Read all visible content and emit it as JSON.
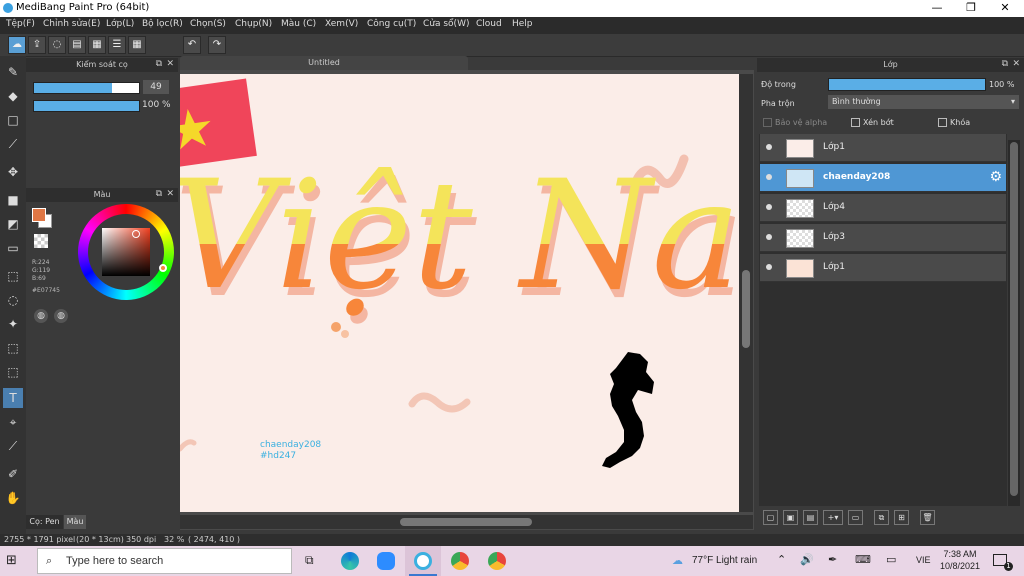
{
  "window": {
    "title": "MediBang Paint Pro (64bit)",
    "minimize": "—",
    "maximize": "❐",
    "close": "✕"
  },
  "menu": [
    "Tệp(F)",
    "Chỉnh sửa(E)",
    "Lớp(L)",
    "Bộ lọc(R)",
    "Chọn(S)",
    "Chụp(N)",
    "Màu (C)",
    "Xem(V)",
    "Công cụ(T)",
    "Cửa sổ(W)",
    "Cloud",
    "Help"
  ],
  "document": {
    "tab_title": "Untitled"
  },
  "brush_panel": {
    "title": "Kiểm soát cọ",
    "size_value": "49",
    "size_fraction": 0.74,
    "opacity_value": "100 %",
    "opacity_fraction": 1.0
  },
  "color_panel": {
    "title": "Màu",
    "r_label": "R:224",
    "g_label": "G:119",
    "b_label": "B:69",
    "hex_label": "#E07745",
    "primary_color": "#E07745",
    "secondary_color": "#ffffff"
  },
  "bottom_tabs": {
    "tab1": "Cọ: Pen",
    "tab2": "Màu"
  },
  "layer_panel": {
    "title": "Lớp",
    "opacity_label": "Độ trong",
    "opacity_value": "100 %",
    "opacity_fraction": 1.0,
    "blend_label": "Pha trộn",
    "blend_value": "Bình thường",
    "protect_alpha": "Bảo vệ alpha",
    "clipping": "Xén bớt",
    "lock": "Khóa",
    "layers": [
      {
        "name": "Lớp1",
        "selected": false
      },
      {
        "name": "chaenday208",
        "selected": true
      },
      {
        "name": "Lớp4",
        "selected": false
      },
      {
        "name": "Lớp3",
        "selected": false
      },
      {
        "name": "Lớp1",
        "selected": false
      }
    ]
  },
  "canvas": {
    "big_text": "Việt Nam",
    "watermark_line1": "chaenday208",
    "watermark_line2": "#hd247"
  },
  "status": {
    "size": "2755 * 1791 pixel",
    "cm": "(20 * 13cm)",
    "dpi": "350 dpi",
    "zoom": "32 %",
    "coords": "( 2474, 410 )"
  },
  "taskbar": {
    "search_placeholder": "Type here to search",
    "weather": "77°F  Light rain",
    "lang": "VIE",
    "time": "7:38 AM",
    "date": "10/8/2021",
    "notif_count": "1"
  },
  "colors": {
    "accent": "#4f97d4",
    "canvas_bg": "#fbede8",
    "text_yellow": "#f5e050",
    "text_orange": "#f08a3a",
    "watermark": "#3ab0e0"
  }
}
